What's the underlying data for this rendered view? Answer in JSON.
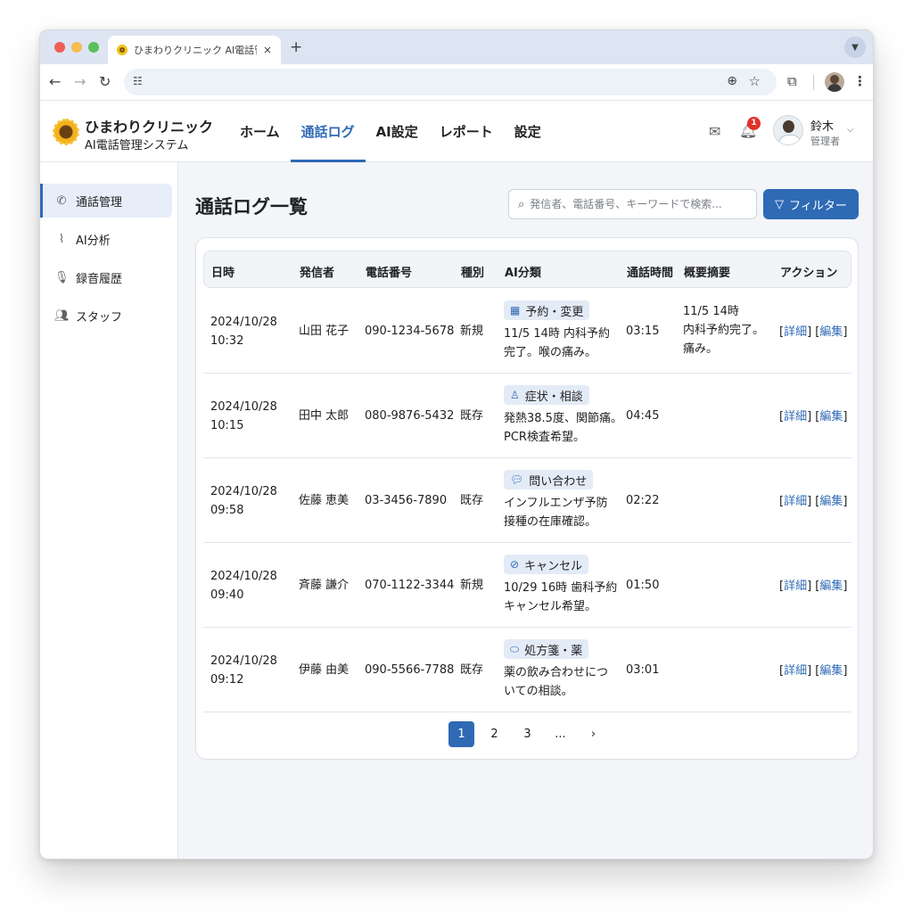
{
  "browser": {
    "tab_title": "ひまわりクリニック AI電話管理",
    "tab_close": "×",
    "new_tab": "+"
  },
  "header": {
    "clinic_name": "ひまわりクリニック",
    "system_name": "AI電話管理システム",
    "nav": [
      {
        "label": "ホーム",
        "active": false
      },
      {
        "label": "通話ログ",
        "active": true
      },
      {
        "label": "AI設定",
        "active": false
      },
      {
        "label": "レポート",
        "active": false
      },
      {
        "label": "設定",
        "active": false
      }
    ],
    "notification_count": "1",
    "user_name": "鈴木",
    "user_role": "管理者"
  },
  "sidebar": {
    "items": [
      {
        "label": "通話管理",
        "icon": "phone-icon",
        "active": true
      },
      {
        "label": "AI分析",
        "icon": "chart-line-icon",
        "active": false
      },
      {
        "label": "録音履歴",
        "icon": "microphone-icon",
        "active": false
      },
      {
        "label": "スタッフ",
        "icon": "users-icon",
        "active": false
      }
    ]
  },
  "main": {
    "title": "通話ログ一覧",
    "search_placeholder": "発信者、電話番号、キーワードで検索...",
    "filter_label": "フィルター",
    "columns": [
      "日時",
      "発信者",
      "電話番号",
      "種別",
      "AI分類",
      "通話時間",
      "概要摘要",
      "アクション"
    ],
    "rows": [
      {
        "date": "2024/10/28",
        "time": "10:32",
        "caller": "山田 花子",
        "phone": "090-1234-5678",
        "type": "新規",
        "ai_category": "予約・変更",
        "ai_icon": "calendar-icon",
        "ai_line1": "11/5 14時 内科予約",
        "ai_line2": "完了。喉の痛み。",
        "duration": "03:15",
        "summary_line1": "11/5 14時",
        "summary_line2": "内科予約完了。",
        "summary_line3": "痛み。"
      },
      {
        "date": "2024/10/28",
        "time": "10:15",
        "caller": "田中 太郎",
        "phone": "080-9876-5432",
        "type": "既存",
        "ai_category": "症状・相談",
        "ai_icon": "person-icon",
        "ai_line1": "発熱38.5度、関節痛。",
        "ai_line2": "PCR検査希望。",
        "duration": "04:45",
        "summary_line1": "",
        "summary_line2": "",
        "summary_line3": ""
      },
      {
        "date": "2024/10/28",
        "time": "09:58",
        "caller": "佐藤 恵美",
        "phone": "03-3456-7890",
        "type": "既存",
        "ai_category": "問い合わせ",
        "ai_icon": "chat-icon",
        "ai_line1": "インフルエンザ予防",
        "ai_line2": "接種の在庫確認。",
        "duration": "02:22",
        "summary_line1": "",
        "summary_line2": "",
        "summary_line3": ""
      },
      {
        "date": "2024/10/28",
        "time": "09:40",
        "caller": "斉藤 謙介",
        "phone": "070-1122-3344",
        "type": "新規",
        "ai_category": "キャンセル",
        "ai_icon": "cancel-icon",
        "ai_line1": "10/29 16時 歯科予約",
        "ai_line2": "キャンセル希望。",
        "duration": "01:50",
        "summary_line1": "",
        "summary_line2": "",
        "summary_line3": ""
      },
      {
        "date": "2024/10/28",
        "time": "09:12",
        "caller": "伊藤 由美",
        "phone": "090-5566-7788",
        "type": "既存",
        "ai_category": "処方箋・薬",
        "ai_icon": "pill-icon",
        "ai_line1": "薬の飲み合わせにつ",
        "ai_line2": "いての相談。",
        "duration": "03:01",
        "summary_line1": "",
        "summary_line2": "",
        "summary_line3": ""
      }
    ],
    "action_detail": "詳細",
    "action_edit": "編集",
    "pagination": {
      "pages": [
        "1",
        "2",
        "3",
        "..."
      ],
      "current": "1",
      "next": "›"
    }
  },
  "colors": {
    "accent": "#2f6ab5",
    "badge_bg": "#e3ebf6",
    "notification": "#e0322b"
  }
}
